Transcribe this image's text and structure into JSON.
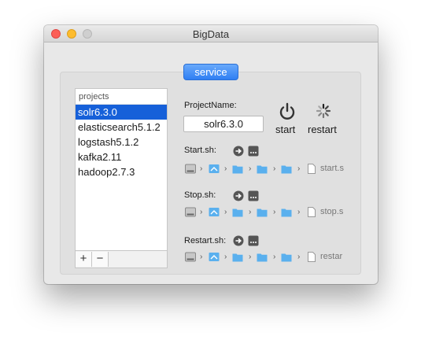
{
  "window": {
    "title": "BigData"
  },
  "tabs": {
    "service": "service"
  },
  "projects": {
    "header": "projects",
    "items": [
      "solr6.3.0",
      "elasticsearch5.1.2",
      "logstash5.1.2",
      "kafka2.11",
      "hadoop2.7.3"
    ],
    "selected": "solr6.3.0",
    "add_label": "+",
    "remove_label": "−"
  },
  "detail": {
    "project_name_label": "ProjectName:",
    "project_name_value": "solr6.3.0",
    "start_label": "start",
    "restart_label": "restart",
    "scripts": [
      {
        "label": "Start.sh:",
        "file": "start.s"
      },
      {
        "label": "Stop.sh:",
        "file": "stop.s"
      },
      {
        "label": "Restart.sh:",
        "file": "restar"
      }
    ]
  },
  "colors": {
    "accent": "#1660d9",
    "folder": "#5ab0ee"
  }
}
